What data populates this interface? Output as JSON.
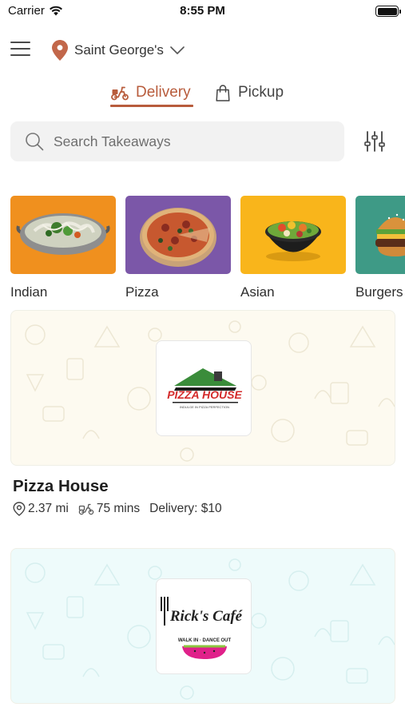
{
  "status_bar": {
    "carrier": "Carrier",
    "time": "8:55 PM"
  },
  "header": {
    "location": "Saint George's"
  },
  "tabs": {
    "delivery": "Delivery",
    "pickup": "Pickup",
    "active": "delivery"
  },
  "search": {
    "placeholder": "Search Takeaways",
    "value": ""
  },
  "categories": [
    {
      "label": "Indian",
      "icon": "karahi-dish-image",
      "bg": "#f0901e"
    },
    {
      "label": "Pizza",
      "icon": "pizza-image",
      "bg": "#7b57a8"
    },
    {
      "label": "Asian",
      "icon": "rice-bowl-image",
      "bg": "#f9b51b"
    },
    {
      "label": "Burgers",
      "icon": "burger-image",
      "bg": "#3e9a86"
    }
  ],
  "restaurants": [
    {
      "name": "Pizza House",
      "distance": "2.37 mi",
      "time": "75 mins",
      "delivery": "Delivery: $10",
      "logo_text": "PIZZA HOUSE",
      "logo_tagline": "INDULGE IN PIZZA PERFECTION",
      "banner_color": "#fdfaf0"
    },
    {
      "name": "Ricks Cafe",
      "logo_text": "Rick's Café",
      "logo_tagline": "WALK IN · DANCE OUT",
      "banner_color": "#eefbfb"
    }
  ],
  "colors": {
    "accent": "#b85c3c",
    "pin": "#c2674a"
  }
}
